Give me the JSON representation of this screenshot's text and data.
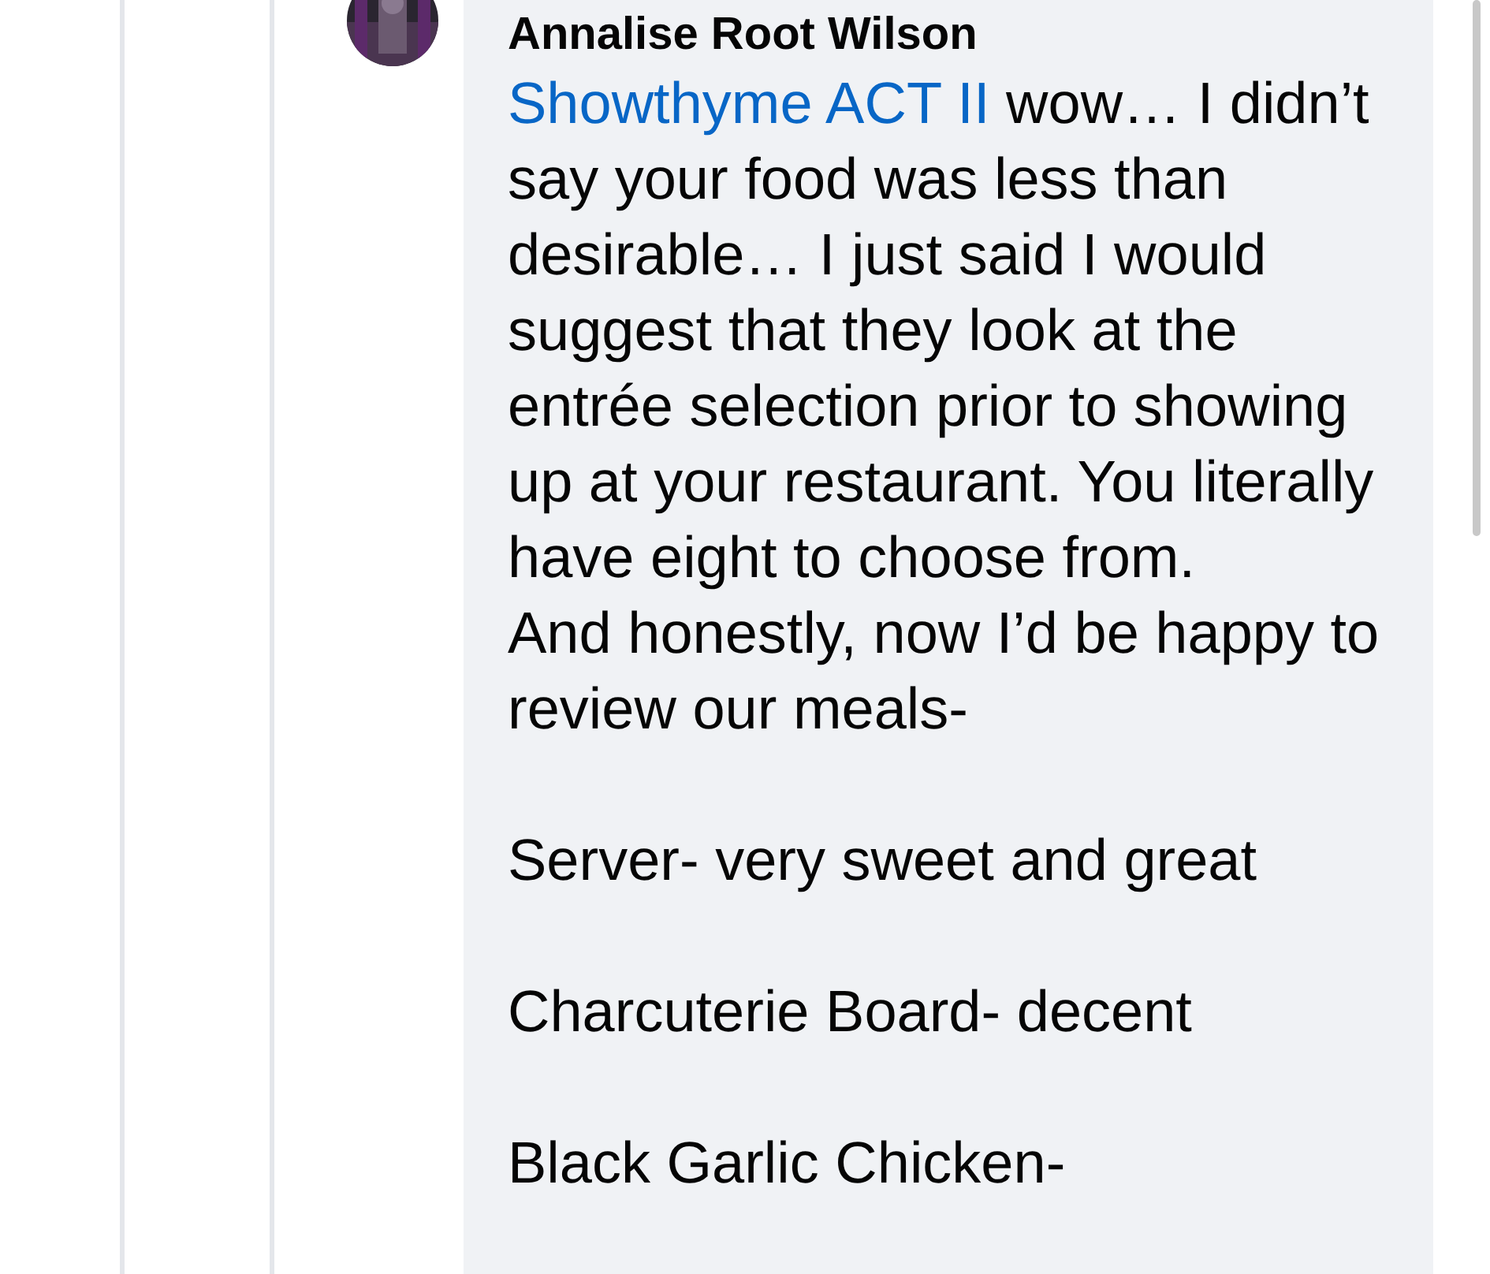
{
  "comment": {
    "author": "Annalise Root Wilson",
    "mention": "Showthyme ACT II",
    "sections": [
      {
        "paragraphs": [
          "wow… I didn’t say your food was less than desirable… I just said I would suggest that they look at the entrée selection prior to showing up at your restaurant. You literally have eight to choose from.",
          "And honestly, now I’d be happy to review our meals-"
        ]
      },
      {
        "paragraphs": [
          "Server- very sweet and great"
        ]
      },
      {
        "paragraphs": [
          "Charcuterie Board- decent"
        ]
      },
      {
        "paragraphs": [
          "Black Garlic Chicken-"
        ]
      }
    ]
  }
}
